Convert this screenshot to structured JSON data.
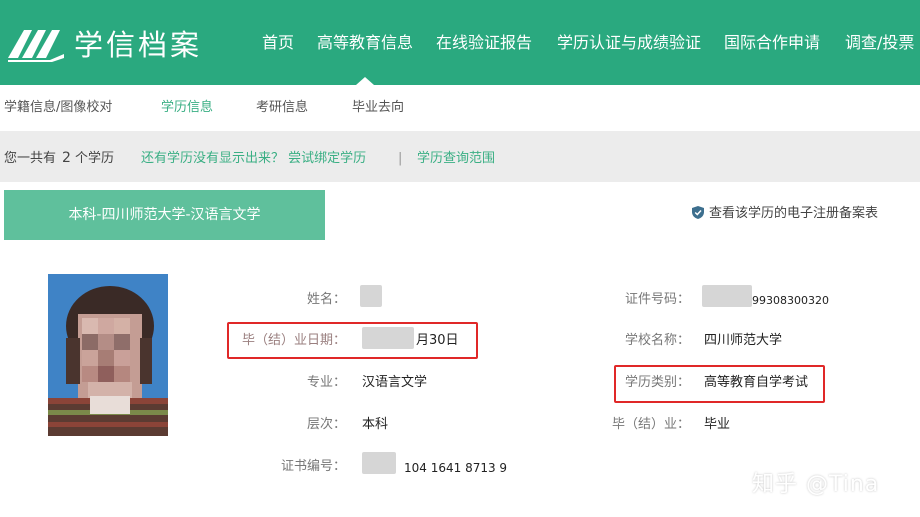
{
  "header": {
    "brand": "学信档案",
    "nav": [
      "首页",
      "高等教育信息",
      "在线验证报告",
      "学历认证与成绩验证",
      "国际合作申请",
      "调查/投票"
    ]
  },
  "subnav": {
    "items": [
      "学籍信息/图像校对",
      "学历信息",
      "考研信息",
      "毕业去向"
    ],
    "active_index": 1
  },
  "infobar": {
    "prefix": "您一共有",
    "count": "2",
    "suffix": "个学历",
    "missing_link": "还有学历没有显示出来？ 尝试绑定学历",
    "separator": "|",
    "scope_link": "学历查询范围"
  },
  "record": {
    "degree_tab": "本科-四川师范大学-汉语言文学",
    "registration_link": "查看该学历的电子注册备案表",
    "fields": {
      "name_label": "姓名：",
      "name_value": "",
      "grad_date_label": "毕（结）业日期：",
      "grad_date_value": "月30日",
      "major_label": "专业：",
      "major_value": "汉语言文学",
      "level_label": "层次：",
      "level_value": "本科",
      "cert_label": "证书编号：",
      "cert_value": "104 1641 8713 9",
      "id_label": "证件号码：",
      "id_value": "99308300320",
      "school_label": "学校名称：",
      "school_value": "四川师范大学",
      "type_label": "学历类别：",
      "type_value": "高等教育自学考试",
      "status_label": "毕（结）业：",
      "status_value": "毕业"
    }
  },
  "watermark": "知乎 @Tina",
  "colors": {
    "header_bg": "#2aa97f",
    "tab_bg": "#5fc09c",
    "accent": "#3aaf84",
    "highlight_border": "#e02828"
  }
}
